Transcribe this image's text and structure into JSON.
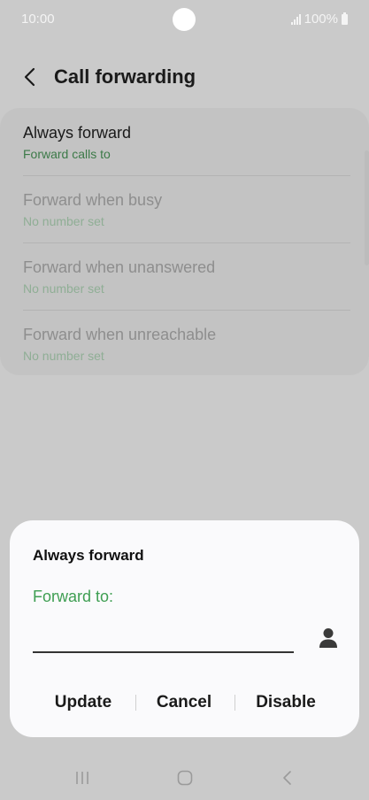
{
  "status_bar": {
    "time": "10:00",
    "battery": "100%",
    "icons": [
      "signal-icon",
      "battery-icon"
    ]
  },
  "header": {
    "title": "Call forwarding",
    "back_icon": "chevron-left-icon"
  },
  "settings": {
    "items": [
      {
        "title": "Always forward",
        "subtitle": "Forward calls to",
        "enabled": true
      },
      {
        "title": "Forward when busy",
        "subtitle": "No number set",
        "enabled": false
      },
      {
        "title": "Forward when unanswered",
        "subtitle": "No number set",
        "enabled": false
      },
      {
        "title": "Forward when unreachable",
        "subtitle": "No number set",
        "enabled": false
      }
    ]
  },
  "dialog": {
    "title": "Always forward",
    "label": "Forward to:",
    "input_value": "",
    "input_placeholder": "",
    "contact_icon": "person-icon",
    "buttons": {
      "update": "Update",
      "cancel": "Cancel",
      "disable": "Disable"
    }
  },
  "nav_bar": {
    "icons": [
      "recents-icon",
      "home-icon",
      "back-icon"
    ]
  },
  "colors": {
    "accent_green": "#3e9e52",
    "subtitle_green": "#3c7a48",
    "scrim": "#cacaca",
    "dialog_bg": "#fafafc"
  }
}
